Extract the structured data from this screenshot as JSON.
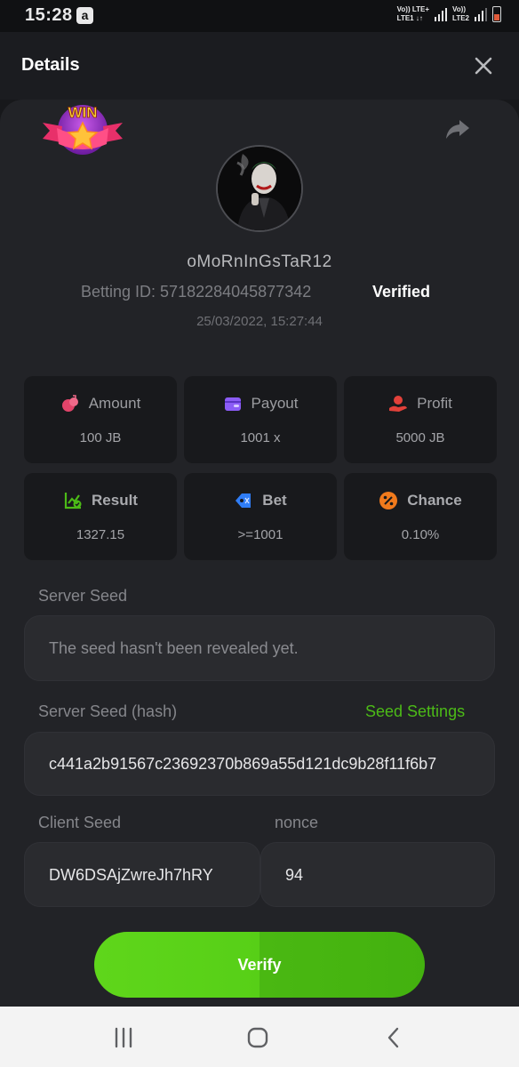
{
  "status_bar": {
    "time": "15:28",
    "app_badge": "a",
    "sim1": [
      "Vo)) LTE+",
      "LTE1 ↓↑"
    ],
    "sim2": [
      "Vo))",
      "LTE2"
    ],
    "battery_level": 0.35
  },
  "header": {
    "title": "Details",
    "close_icon": "close-icon"
  },
  "badge": {
    "text": "WIN"
  },
  "user": {
    "username": "oMoRnInGsTaR12",
    "betting_id": "Betting ID: 57182284045877342",
    "verified": "Verified",
    "timestamp": "25/03/2022, 15:27:44"
  },
  "stats": {
    "amount": {
      "label": "Amount",
      "value": "100 JB",
      "icon": "amount-icon",
      "color": "#e2446a"
    },
    "payout": {
      "label": "Payout",
      "value": "1001 x",
      "icon": "wallet-icon",
      "color": "#8b5cf6"
    },
    "profit": {
      "label": "Profit",
      "value": "5000 JB",
      "icon": "profit-icon",
      "color": "#e2413a"
    },
    "result": {
      "label": "Result",
      "value": "1327.15",
      "icon": "chart-check-icon",
      "color": "#4cbb17"
    },
    "bet": {
      "label": "Bet",
      "value": ">=1001",
      "icon": "tag-icon",
      "color": "#2f7df6"
    },
    "chance": {
      "label": "Chance",
      "value": "0.10%",
      "icon": "percent-icon",
      "color": "#f07a1c"
    }
  },
  "server_seed": {
    "label": "Server Seed",
    "value": "The seed hasn't been revealed yet."
  },
  "server_seed_hash": {
    "label": "Server Seed (hash)",
    "settings_link": "Seed Settings",
    "value": "c441a2b91567c23692370b869a55d121dc9b28f11f6b7"
  },
  "client_seed": {
    "label": "Client Seed",
    "value": "DW6DSAjZwreJh7hRY"
  },
  "nonce": {
    "label": "nonce",
    "value": "94"
  },
  "verify_button": {
    "label": "Verify"
  },
  "colors": {
    "accent_green": "#4cbb17",
    "background": "#17181b",
    "card": "#222327"
  }
}
